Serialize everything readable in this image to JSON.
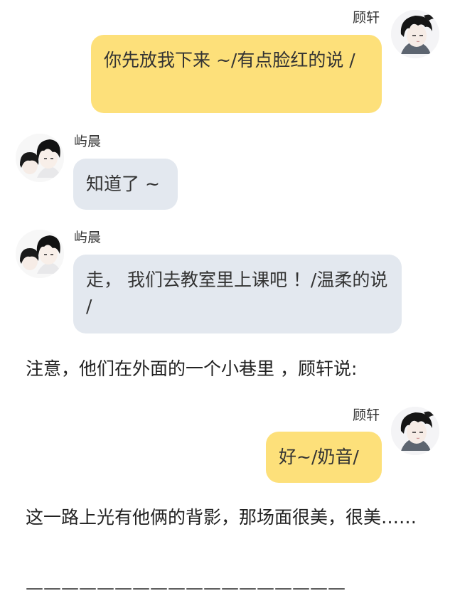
{
  "messages": [
    {
      "side": "right",
      "sender": "顾轩",
      "text": "你先放我下来 ~/有点脸红的说 /"
    },
    {
      "side": "left",
      "sender": "屿晨",
      "text": "知道了 ~"
    },
    {
      "side": "left",
      "sender": "屿晨",
      "text": "走， 我们去教室里上课吧 ！/温柔的说 /"
    },
    {
      "side": "right",
      "sender": "顾轩",
      "text": "好~/奶音/"
    }
  ],
  "narrations": [
    "注意，他们在外面的一个小巷里 ，顾轩说:",
    "这一路上光有他俩的背影，那场面很美，很美……"
  ],
  "divider": "——————————————————",
  "avatars": {
    "guxuan": "boy-black-hair-avatar-icon",
    "yuchen": "two-boys-avatar-icon"
  },
  "colors": {
    "right_bubble": "#fde07a",
    "left_bubble": "#e3e8ef"
  }
}
